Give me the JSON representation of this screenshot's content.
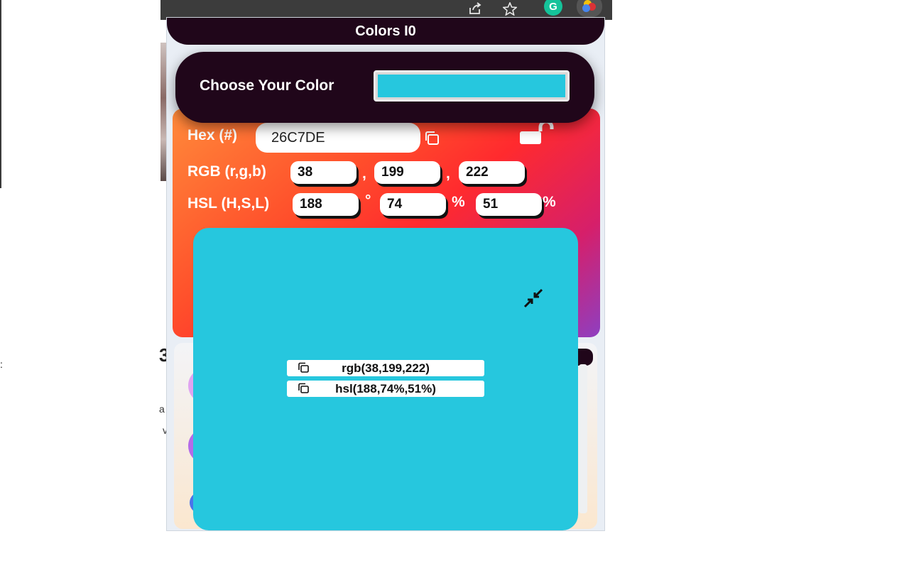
{
  "popup": {
    "title": "Colors I0",
    "chooser": {
      "label": "Choose Your Color",
      "value_color": "#26C7DE"
    },
    "hex": {
      "label": "Hex (#)",
      "value": "26C7DE"
    },
    "rgb": {
      "label": "RGB (r,g,b)",
      "r": "38",
      "g": "199",
      "b": "222",
      "separator": ","
    },
    "hsl": {
      "label": "HSL (H,S,L)",
      "h": "188",
      "s": "74",
      "l": "51",
      "deg_unit": "°",
      "pct_unit": "%"
    },
    "preview": {
      "color": "#26C7DE",
      "rgb_text": "rgb(38,199,222)",
      "hsl_text": "hsl(188,74%,51%)"
    }
  },
  "browser_toolbar": {
    "icons": [
      "share-icon",
      "star-icon",
      "grammarly-icon",
      "colors-extension-icon"
    ]
  },
  "colors": {
    "accent": "#20061A",
    "selected": "#26C7DE",
    "grammarly": "#15C39A"
  }
}
